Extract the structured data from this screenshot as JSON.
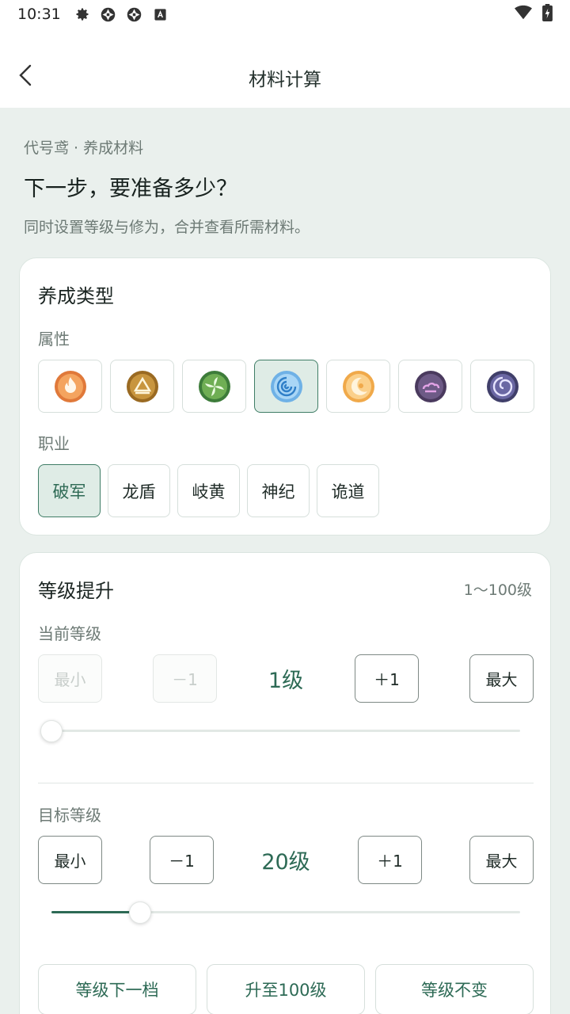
{
  "status_bar": {
    "time": "10:31",
    "icons": [
      "gear-icon",
      "aperture-icon",
      "aperture-icon",
      "font-a-icon"
    ],
    "right_icons": [
      "wifi-icon",
      "battery-icon"
    ]
  },
  "app_bar": {
    "title": "材料计算",
    "back_icon": "chevron-left-icon"
  },
  "intro": {
    "breadcrumb": "代号鸢 · 养成材料",
    "headline": "下一步，要准备多少？",
    "description": "同时设置等级与修为，合并查看所需材料。"
  },
  "cultivation_type": {
    "title": "养成类型",
    "attribute_label": "属性",
    "attributes": [
      {
        "icon": "fire-icon",
        "selected": false
      },
      {
        "icon": "earth-icon",
        "selected": false
      },
      {
        "icon": "wind-leaf-icon",
        "selected": false
      },
      {
        "icon": "water-swirl-icon",
        "selected": true
      },
      {
        "icon": "light-moon-icon",
        "selected": false
      },
      {
        "icon": "dark-cloud-icon",
        "selected": false
      },
      {
        "icon": "void-spiral-icon",
        "selected": false
      }
    ],
    "job_label": "职业",
    "jobs": [
      {
        "label": "破军",
        "selected": true
      },
      {
        "label": "龙盾",
        "selected": false
      },
      {
        "label": "岐黄",
        "selected": false
      },
      {
        "label": "神纪",
        "selected": false
      },
      {
        "label": "诡道",
        "selected": false
      }
    ]
  },
  "level_up": {
    "title": "等级提升",
    "range": "1～100级",
    "current": {
      "label": "当前等级",
      "min_label": "最小",
      "minus_label": "－1",
      "value": "1级",
      "plus_label": "＋1",
      "max_label": "最大",
      "slider_fraction": 0.0
    },
    "target": {
      "label": "目标等级",
      "min_label": "最小",
      "minus_label": "－1",
      "value": "20级",
      "plus_label": "＋1",
      "max_label": "最大",
      "slider_fraction": 0.19
    },
    "quick_actions": [
      "等级下一档",
      "升至100级",
      "等级不变"
    ]
  },
  "colors": {
    "accent": "#2d6a55",
    "selected_bg": "#dfece6",
    "page_bg": "#eaf0ed"
  }
}
